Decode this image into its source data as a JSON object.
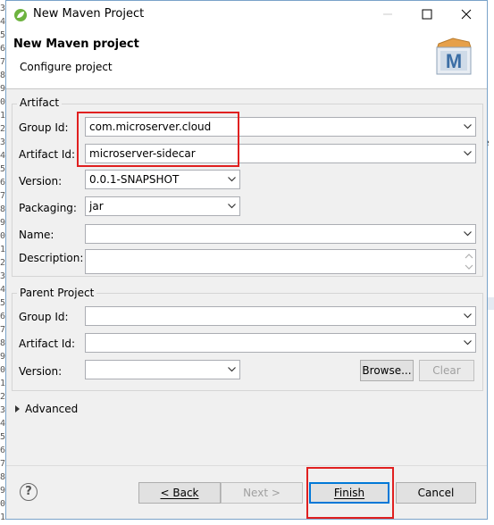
{
  "gutter": [
    "3",
    "4",
    "5",
    "6",
    "7",
    "8",
    "9",
    "0",
    "1",
    "2",
    "3",
    "4",
    "5",
    "6",
    "7",
    "8",
    "9",
    "0",
    "1",
    "2",
    "3",
    "4",
    "5",
    "6",
    "7",
    "8",
    "9",
    "0",
    "1",
    "2",
    "3",
    "4",
    "5",
    "6",
    "7",
    "8",
    "9",
    "0",
    "1"
  ],
  "right_fragment": "e",
  "window": {
    "title": "New Maven Project",
    "minimize_icon": "minimize-icon",
    "maximize_icon": "maximize-icon",
    "close_icon": "close-icon"
  },
  "header": {
    "title": "New Maven project",
    "subtitle": "Configure project",
    "logo_letter": "M"
  },
  "artifact": {
    "group_label": "Artifact",
    "group_id_label": "Group Id:",
    "group_id_value": "com.microserver.cloud",
    "artifact_id_label": "Artifact Id:",
    "artifact_id_value": "microserver-sidecar",
    "version_label": "Version:",
    "version_value": "0.0.1-SNAPSHOT",
    "packaging_label": "Packaging:",
    "packaging_value": "jar",
    "name_label": "Name:",
    "name_value": "",
    "description_label": "Description:",
    "description_value": ""
  },
  "parent": {
    "group_label": "Parent Project",
    "group_id_label": "Group Id:",
    "group_id_value": "",
    "artifact_id_label": "Artifact Id:",
    "artifact_id_value": "",
    "version_label": "Version:",
    "version_value": "",
    "browse_label": "Browse...",
    "clear_label": "Clear"
  },
  "advanced_label": "Advanced",
  "footer": {
    "help_glyph": "?",
    "back_label": "< Back",
    "back_mnemonic": "B",
    "next_label": "Next >",
    "finish_label": "Finish",
    "cancel_label": "Cancel"
  },
  "colors": {
    "highlight_box": "#e02020",
    "dialog_bg": "#f0f0f0",
    "default_button_border": "#0078d7"
  }
}
